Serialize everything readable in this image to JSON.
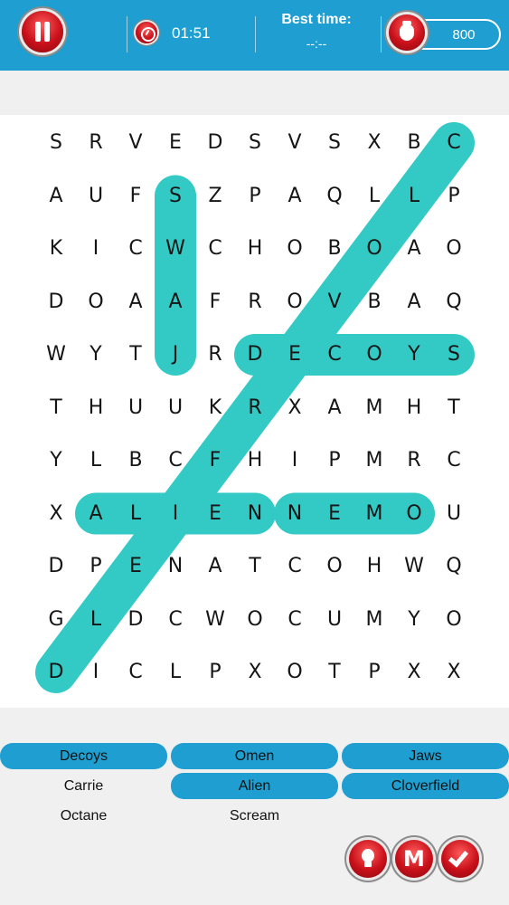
{
  "header": {
    "timer": "01:51",
    "best_time_label": "Best time:",
    "best_time_value": "--:--",
    "coins": "800"
  },
  "colors": {
    "header": "#1f9fd1",
    "highlight": "#33c9c4",
    "found_word": "#1f9fd1",
    "button_red": "#c8101a"
  },
  "icons": [
    "pause-icon",
    "timer-icon",
    "coin-bag-icon",
    "hint-bulb-icon",
    "m-icon",
    "check-icon"
  ],
  "grid": {
    "rows": [
      [
        "S",
        "R",
        "V",
        "E",
        "D",
        "S",
        "V",
        "S",
        "X",
        "B",
        "C"
      ],
      [
        "A",
        "U",
        "F",
        "S",
        "Z",
        "P",
        "A",
        "Q",
        "L",
        "L",
        "P"
      ],
      [
        "K",
        "I",
        "C",
        "W",
        "C",
        "H",
        "O",
        "B",
        "O",
        "A",
        "O"
      ],
      [
        "D",
        "O",
        "A",
        "A",
        "F",
        "R",
        "O",
        "V",
        "B",
        "A",
        "Q"
      ],
      [
        "W",
        "Y",
        "T",
        "J",
        "R",
        "D",
        "E",
        "C",
        "O",
        "Y",
        "S"
      ],
      [
        "T",
        "H",
        "U",
        "U",
        "K",
        "R",
        "X",
        "A",
        "M",
        "H",
        "T"
      ],
      [
        "Y",
        "L",
        "B",
        "C",
        "F",
        "H",
        "I",
        "P",
        "M",
        "R",
        "C"
      ],
      [
        "X",
        "A",
        "L",
        "I",
        "E",
        "N",
        "N",
        "E",
        "M",
        "O",
        "U"
      ],
      [
        "D",
        "P",
        "E",
        "N",
        "A",
        "T",
        "C",
        "O",
        "H",
        "W",
        "Q"
      ],
      [
        "G",
        "L",
        "D",
        "C",
        "W",
        "O",
        "C",
        "U",
        "M",
        "Y",
        "O"
      ],
      [
        "D",
        "I",
        "C",
        "L",
        "P",
        "X",
        "O",
        "T",
        "P",
        "X",
        "X"
      ]
    ],
    "found_paths": [
      {
        "word": "SWAJ",
        "from": [
          1,
          3
        ],
        "to": [
          4,
          3
        ]
      },
      {
        "word": "DECOYS",
        "from": [
          4,
          5
        ],
        "to": [
          4,
          10
        ]
      },
      {
        "word": "ALIEN",
        "from": [
          7,
          1
        ],
        "to": [
          7,
          5
        ]
      },
      {
        "word": "NEMO",
        "from": [
          7,
          6
        ],
        "to": [
          7,
          9
        ]
      },
      {
        "word": "CLOVERFIELD",
        "from": [
          0,
          10
        ],
        "to": [
          10,
          0
        ]
      }
    ]
  },
  "words": [
    {
      "label": "Decoys",
      "found": true
    },
    {
      "label": "Omen",
      "found": true
    },
    {
      "label": "Jaws",
      "found": true
    },
    {
      "label": "Carrie",
      "found": false
    },
    {
      "label": "Alien",
      "found": true
    },
    {
      "label": "Cloverfield",
      "found": true
    },
    {
      "label": "Octane",
      "found": false
    },
    {
      "label": "Scream",
      "found": false
    }
  ]
}
